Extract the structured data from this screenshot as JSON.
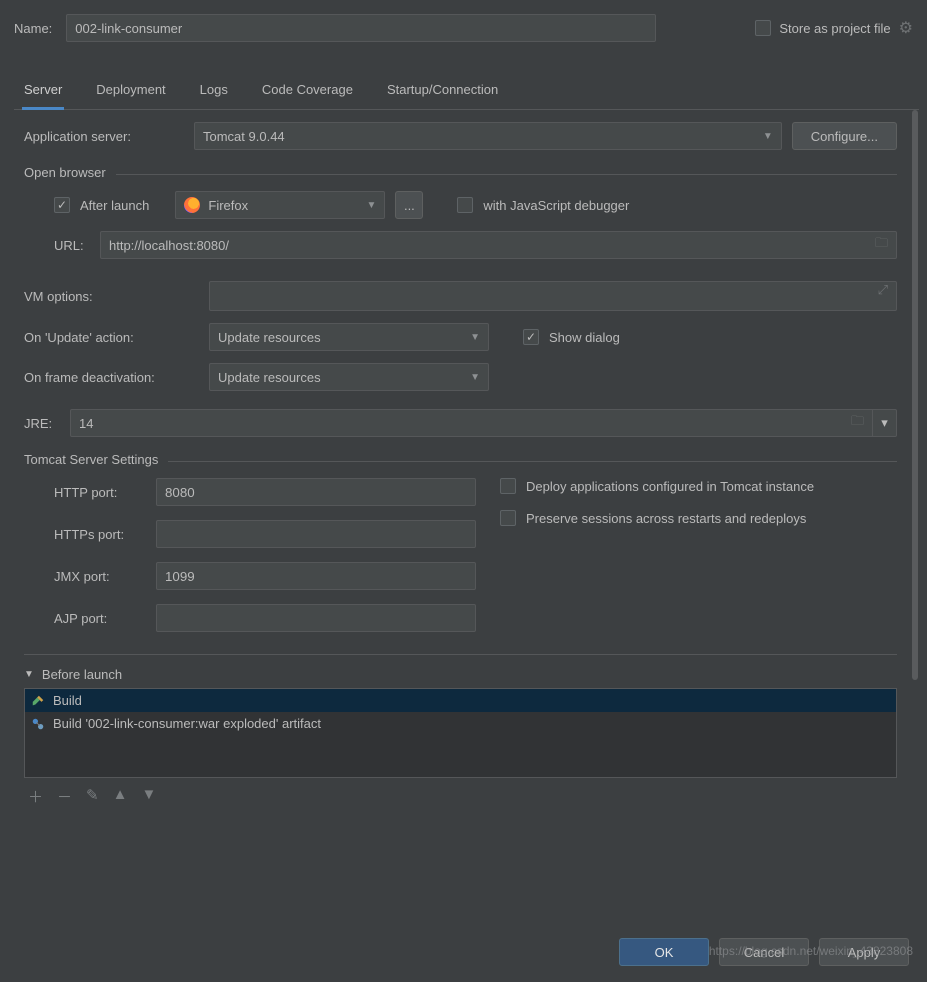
{
  "header": {
    "name_label": "Name:",
    "name_value": "002-link-consumer",
    "store_label": "Store as project file",
    "store_checked": false
  },
  "tabs": [
    "Server",
    "Deployment",
    "Logs",
    "Code Coverage",
    "Startup/Connection"
  ],
  "active_tab": "Server",
  "app_server": {
    "label": "Application server:",
    "value": "Tomcat 9.0.44",
    "configure_btn": "Configure..."
  },
  "open_browser": {
    "legend": "Open browser",
    "after_launch_label": "After launch",
    "after_launch_checked": true,
    "browser_value": "Firefox",
    "ellipsis": "...",
    "js_debug_label": "with JavaScript debugger",
    "js_debug_checked": false,
    "url_label": "URL:",
    "url_value": "http://localhost:8080/"
  },
  "vm": {
    "label": "VM options:",
    "value": ""
  },
  "update": {
    "label": "On 'Update' action:",
    "value": "Update resources",
    "show_dialog_label": "Show dialog",
    "show_dialog_checked": true
  },
  "frame": {
    "label": "On frame deactivation:",
    "value": "Update resources"
  },
  "jre": {
    "label": "JRE:",
    "value": "14"
  },
  "tomcat": {
    "legend": "Tomcat Server Settings",
    "http_label": "HTTP port:",
    "http_value": "8080",
    "https_label": "HTTPs port:",
    "https_value": "",
    "jmx_label": "JMX port:",
    "jmx_value": "1099",
    "ajp_label": "AJP port:",
    "ajp_value": "",
    "deploy_label": "Deploy applications configured in Tomcat instance",
    "deploy_checked": false,
    "preserve_label": "Preserve sessions across restarts and redeploys",
    "preserve_checked": false
  },
  "before_launch": {
    "legend": "Before launch",
    "items": [
      "Build",
      "Build '002-link-consumer:war exploded' artifact"
    ]
  },
  "bottom": {
    "ok": "OK",
    "cancel": "Cancel",
    "apply": "Apply"
  },
  "watermark": "https://blog.csdn.net/weixin_43823808"
}
